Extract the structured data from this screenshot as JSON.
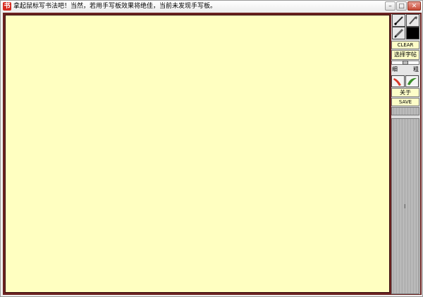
{
  "window": {
    "title": "拿起鼠标写书法吧！当然，若用手写板效果将绝佳，当前未发现手写板。",
    "app_icon_glyph": "书",
    "minimize_glyph": "–",
    "maximize_glyph": "□",
    "close_glyph": "✕"
  },
  "canvas": {
    "background": "#ffffc1"
  },
  "tools": {
    "brush_color": "#000000",
    "clear_label": "CLEAR",
    "select_copybook_label": "选择字帖",
    "thin_label": "细",
    "thick_label": "粗",
    "about_label": "关于",
    "save_label": "SAVE",
    "scroll_marker": "I"
  }
}
